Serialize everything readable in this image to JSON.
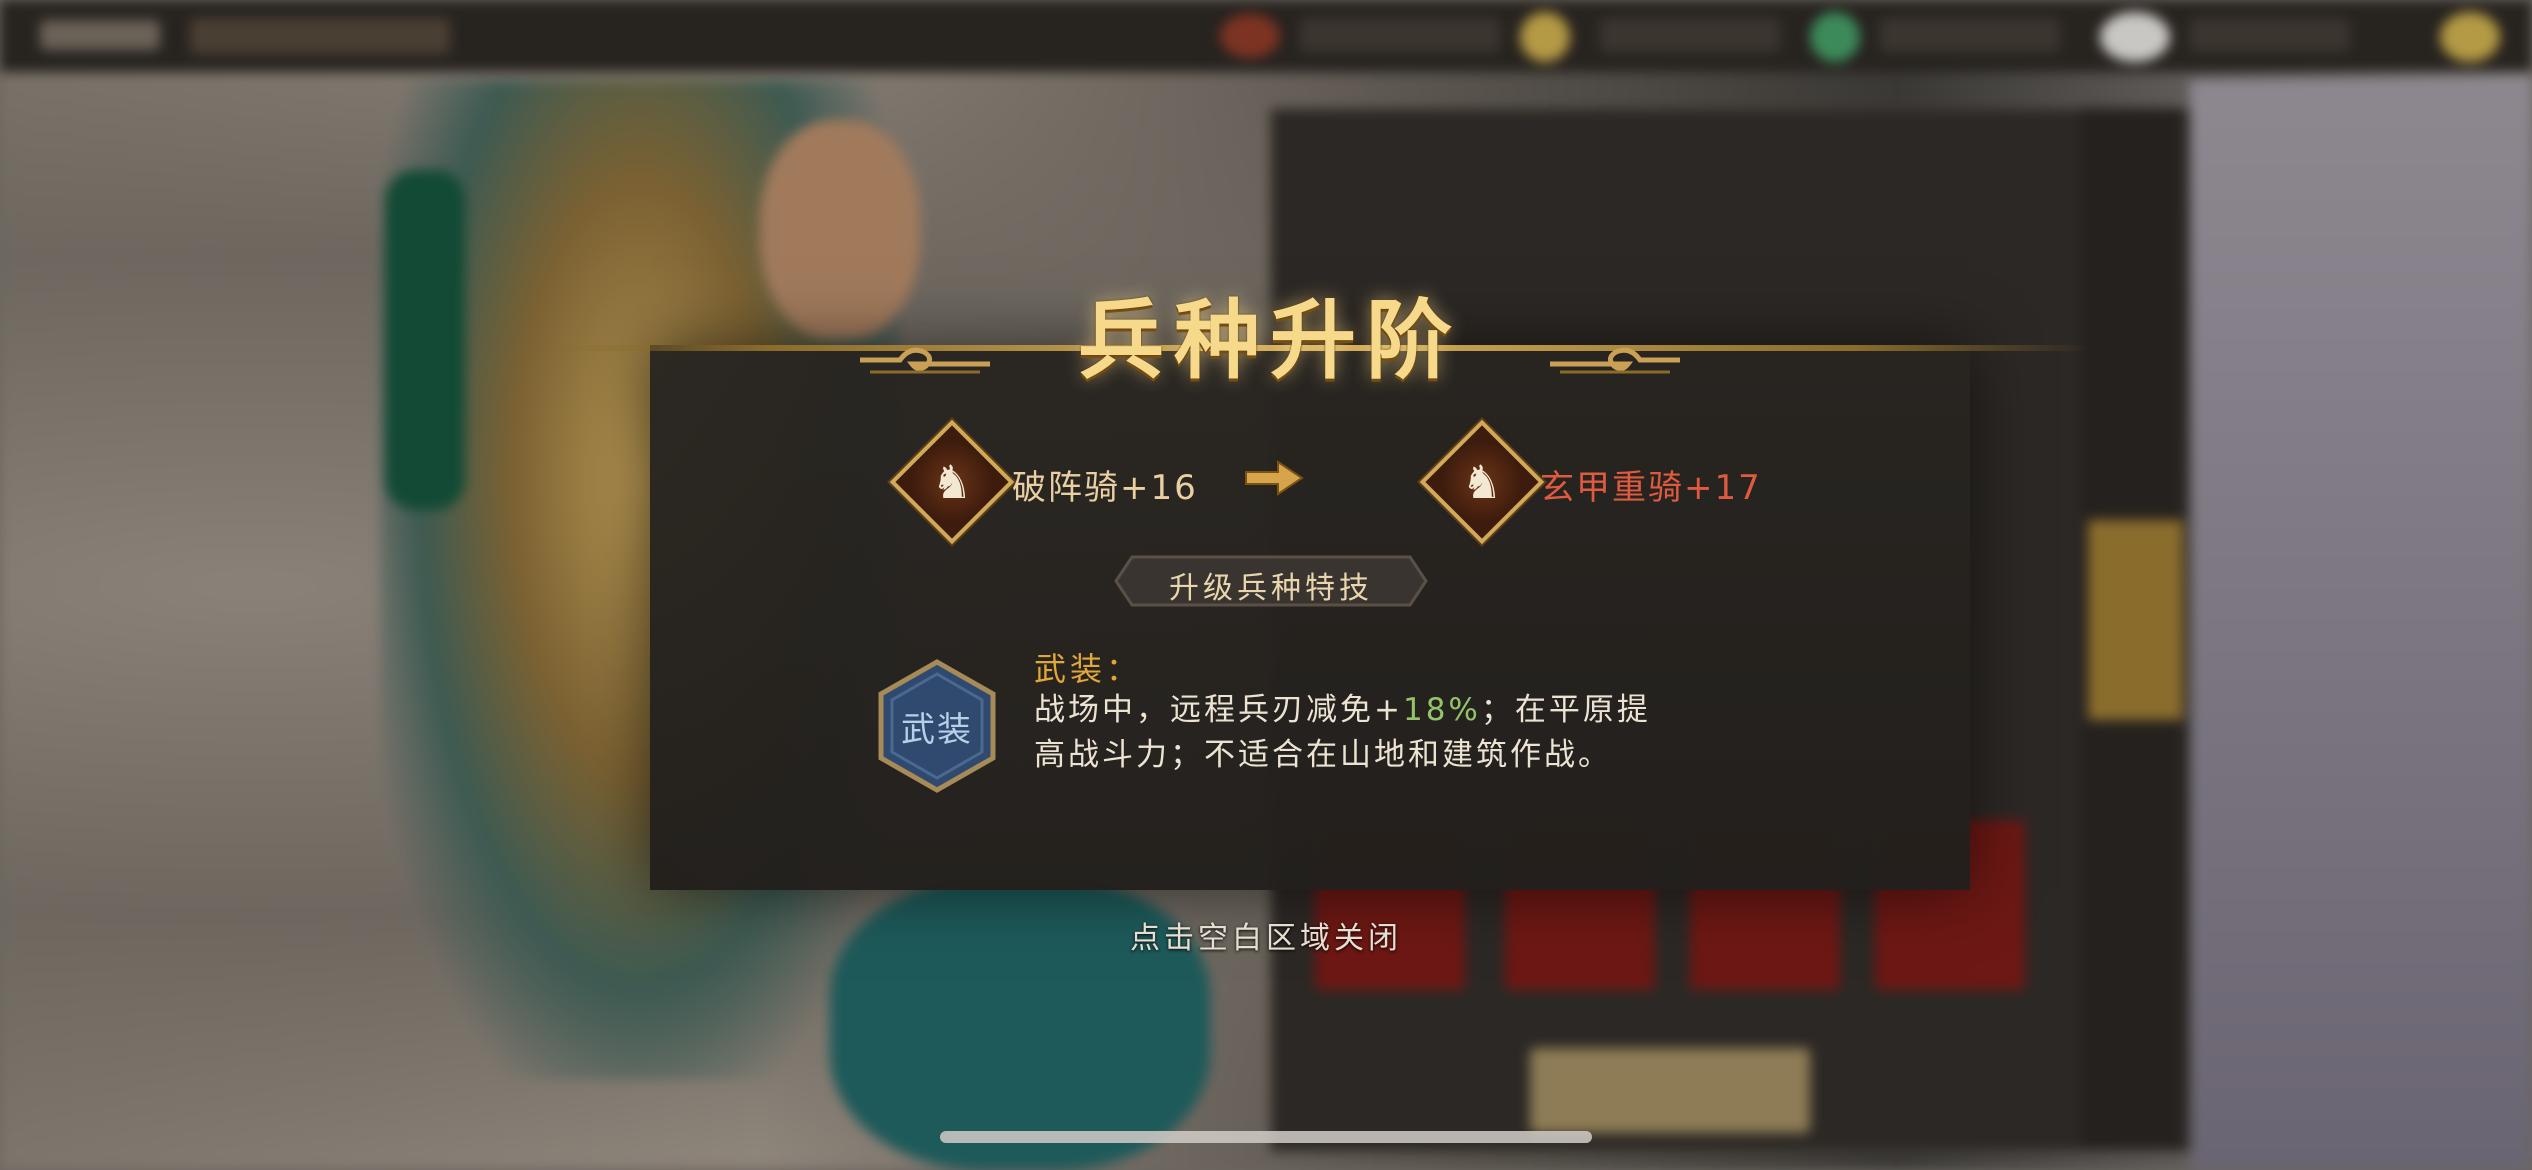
{
  "dialog": {
    "title": "兵种升阶",
    "from_unit": "破阵骑+16",
    "to_unit": "玄甲重骑+17",
    "section_label": "升级兵种特技",
    "skill": {
      "badge": "武装",
      "name": "武装：",
      "desc_before": "战场中，远程兵刃减免+",
      "desc_value": "18%",
      "desc_after": "；在平原提高战斗力；不适合在山地和建筑作战。"
    },
    "close_hint": "点击空白区域关闭"
  },
  "colors": {
    "title_gold": "#f6d98a",
    "from_unit": "#e9cfa2",
    "to_unit": "#e05a40",
    "skill_name": "#e2a739",
    "highlight_green": "#94c46a",
    "badge_blue": "#2f4a6e"
  },
  "icons": {
    "unit_from": "horse-head-icon",
    "unit_to": "horse-head-icon",
    "arrow": "right-arrow-icon"
  }
}
